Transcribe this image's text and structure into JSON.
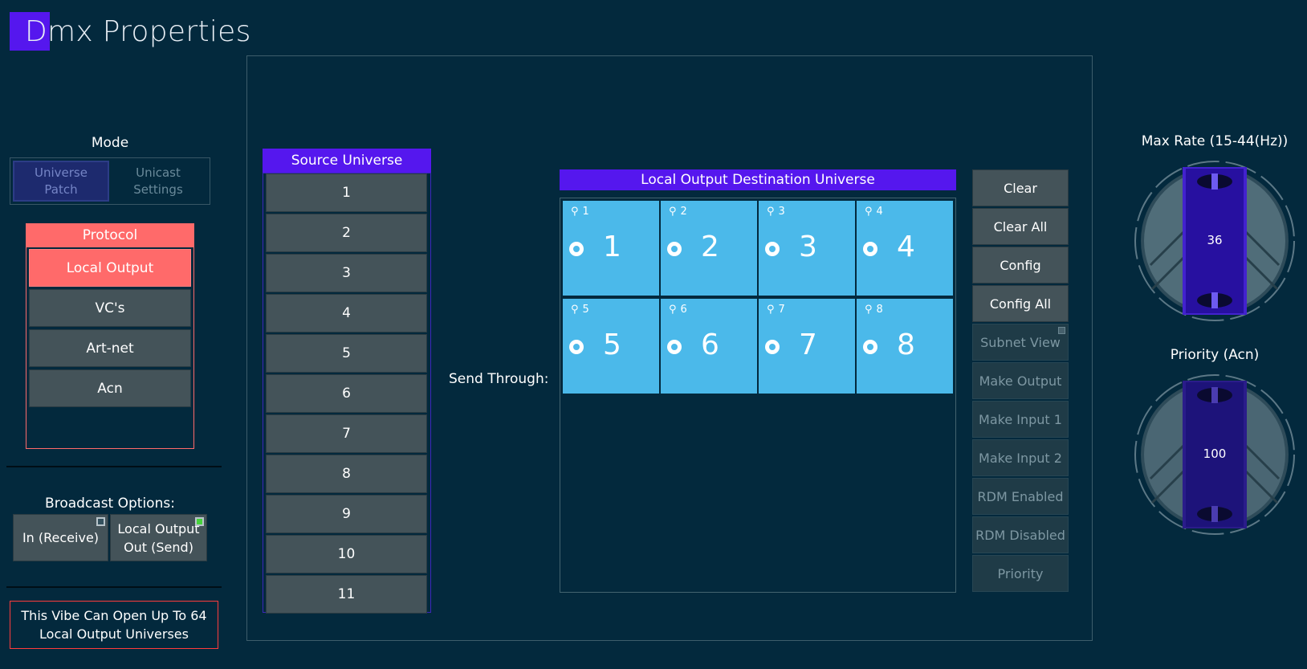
{
  "page": {
    "title": "Dmx Properties"
  },
  "mode": {
    "label": "Mode",
    "options": [
      {
        "line1": "Universe",
        "line2": "Patch",
        "active": true
      },
      {
        "line1": "Unicast",
        "line2": "Settings",
        "active": false
      }
    ]
  },
  "protocol": {
    "header": "Protocol",
    "options": [
      {
        "label": "Local Output",
        "active": true
      },
      {
        "label": "VC's",
        "active": false
      },
      {
        "label": "Art-net",
        "active": false
      },
      {
        "label": "Acn",
        "active": false
      }
    ]
  },
  "broadcast": {
    "label": "Broadcast Options:",
    "in_btn": {
      "line1": "In (Receive)",
      "checked": false
    },
    "out_btn": {
      "line1": "Local Output",
      "line2": "Out (Send)",
      "checked": true
    }
  },
  "info": {
    "line1": "This Vibe Can Open Up To 64",
    "line2": "Local Output Universes"
  },
  "source": {
    "header": "Source Universe",
    "items": [
      "1",
      "2",
      "3",
      "4",
      "5",
      "6",
      "7",
      "8",
      "9",
      "10",
      "11"
    ]
  },
  "send_through_label": "Send Through:",
  "destination": {
    "header": "Local Output Destination Universe",
    "tiles": [
      {
        "index": "1",
        "number": "1"
      },
      {
        "index": "2",
        "number": "2"
      },
      {
        "index": "3",
        "number": "3"
      },
      {
        "index": "4",
        "number": "4"
      },
      {
        "index": "5",
        "number": "5"
      },
      {
        "index": "6",
        "number": "6"
      },
      {
        "index": "7",
        "number": "7"
      },
      {
        "index": "8",
        "number": "8"
      }
    ]
  },
  "actions": {
    "clear": "Clear",
    "clear_all": "Clear All",
    "config": "Config",
    "config_all": "Config All",
    "subnet_view": "Subnet View",
    "make_output": "Make Output",
    "make_input_1": "Make Input 1",
    "make_input_2": "Make Input 2",
    "rdm_enabled": "RDM Enabled",
    "rdm_disabled": "RDM Disabled",
    "priority": "Priority"
  },
  "max_rate": {
    "label": "Max Rate (15-44(Hz))",
    "value": "36"
  },
  "priority_knob": {
    "label": "Priority (Acn)",
    "value": "100"
  },
  "colors": {
    "background": "#03293d",
    "accent_purple": "#5517ee",
    "protocol_red": "#ff6a6a",
    "tile_blue": "#4bb9ea",
    "button_gray": "#445359",
    "indicator_green": "#46d23c"
  }
}
